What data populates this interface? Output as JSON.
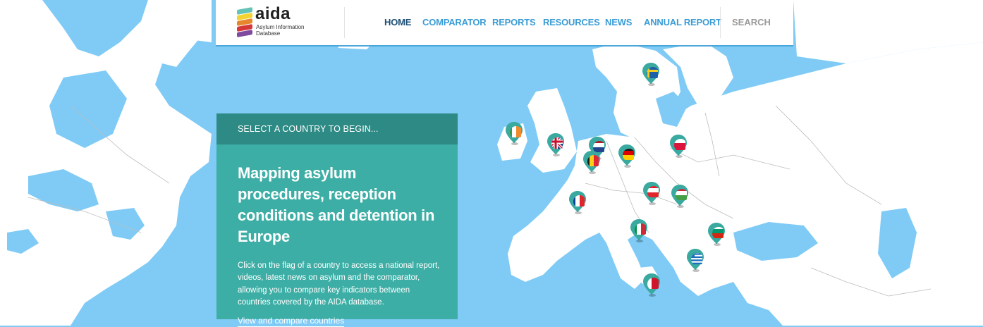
{
  "brand": {
    "name": "aida",
    "subtitle_line1": "Asylum Information",
    "subtitle_line2": "Database",
    "colors": [
      "#62c3b6",
      "#f3d332",
      "#e6872d",
      "#d6383a",
      "#7e4aa0"
    ]
  },
  "nav": {
    "items": [
      "HOME",
      "COMPARATOR",
      "REPORTS",
      "RESOURCES",
      "NEWS",
      "ANNUAL REPORT"
    ],
    "active": "HOME",
    "search_label": "SEARCH"
  },
  "panel": {
    "header": "SELECT A COUNTRY TO BEGIN...",
    "title": "Mapping asylum procedures, reception conditions and detention in Europe",
    "body": "Click on the flag of a country to access a national report, videos, latest news on asylum and the comparator, allowing you to compare key indicators between countries covered by the AIDA database.",
    "link": "View and compare countries"
  },
  "map": {
    "sea_color": "#7fcbf6",
    "land_color": "#ffffff",
    "pin_color": "#3aa9a0",
    "flags": [
      {
        "country": "sweden",
        "icon": "flag-sweden-icon"
      },
      {
        "country": "ireland",
        "icon": "flag-ireland-icon"
      },
      {
        "country": "united-kingdom",
        "icon": "flag-uk-icon"
      },
      {
        "country": "netherlands",
        "icon": "flag-netherlands-icon"
      },
      {
        "country": "belgium",
        "icon": "flag-belgium-icon"
      },
      {
        "country": "germany",
        "icon": "flag-germany-icon"
      },
      {
        "country": "poland",
        "icon": "flag-poland-icon"
      },
      {
        "country": "france",
        "icon": "flag-france-icon"
      },
      {
        "country": "austria",
        "icon": "flag-austria-icon"
      },
      {
        "country": "hungary",
        "icon": "flag-hungary-icon"
      },
      {
        "country": "italy",
        "icon": "flag-italy-icon"
      },
      {
        "country": "bulgaria",
        "icon": "flag-bulgaria-icon"
      },
      {
        "country": "greece",
        "icon": "flag-greece-icon"
      },
      {
        "country": "malta",
        "icon": "flag-malta-icon"
      }
    ]
  }
}
